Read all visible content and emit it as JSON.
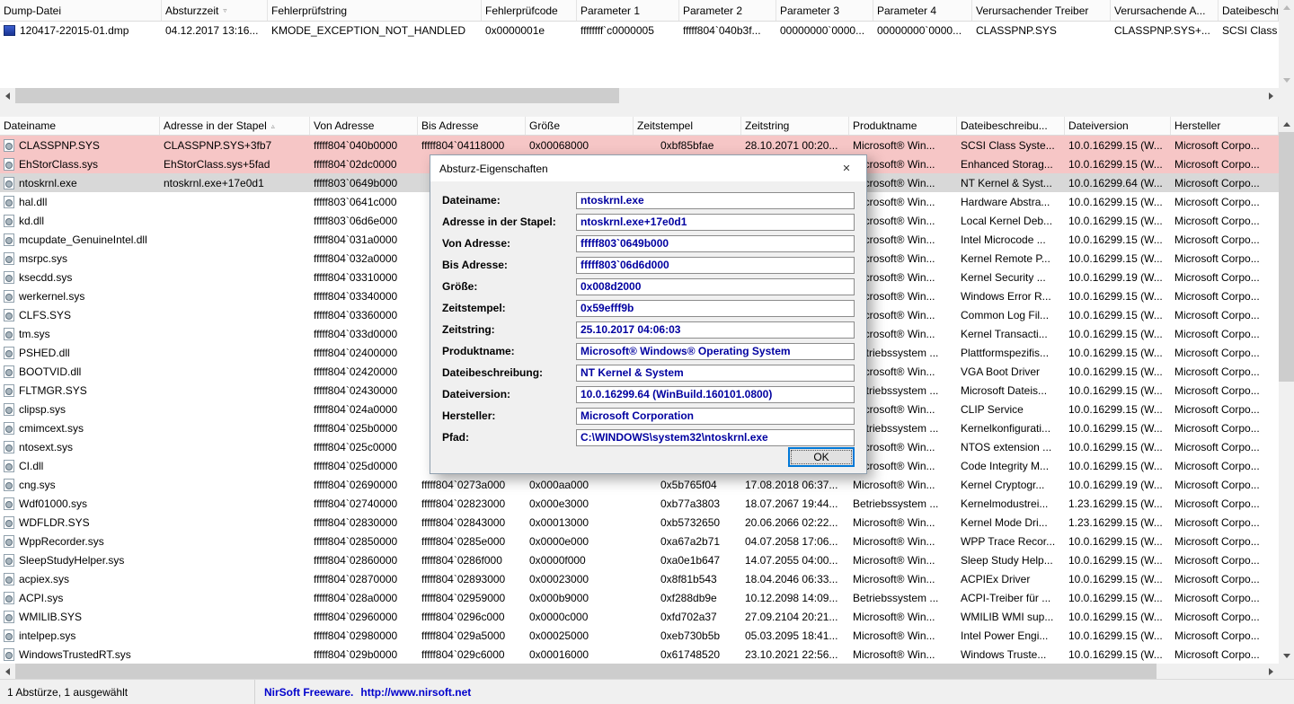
{
  "colors": {
    "pink_row": "#f6c6c6",
    "selected_row": "#d8d8d8",
    "field_text": "#0000a0",
    "accent": "#0078d7",
    "link": "#0000cc"
  },
  "icons": {
    "close": "✕",
    "sort_asc": "▵",
    "sort_desc": "▿"
  },
  "top_pane": {
    "row_icon": "dump-file-icon",
    "columns": [
      {
        "label": "Dump-Datei"
      },
      {
        "label": "Absturzzeit",
        "sort": "desc"
      },
      {
        "label": "Fehlerprüfstring"
      },
      {
        "label": "Fehlerprüfcode"
      },
      {
        "label": "Parameter 1"
      },
      {
        "label": "Parameter 2"
      },
      {
        "label": "Parameter 3"
      },
      {
        "label": "Parameter 4"
      },
      {
        "label": "Verursachender Treiber"
      },
      {
        "label": "Verursachende A..."
      },
      {
        "label": "Dateibeschre..."
      }
    ],
    "rows": [
      {
        "state": "",
        "cells": [
          "120417-22015-01.dmp",
          "04.12.2017 13:16...",
          "KMODE_EXCEPTION_NOT_HANDLED",
          "0x0000001e",
          "ffffffff`c0000005",
          "fffff804`040b3f...",
          "00000000`0000...",
          "00000000`0000...",
          "CLASSPNP.SYS",
          "CLASSPNP.SYS+...",
          "SCSI Class Sy..."
        ]
      }
    ]
  },
  "bottom_pane": {
    "row_icon": "driver-file-icon",
    "columns": [
      {
        "label": "Dateiname"
      },
      {
        "label": "Adresse in der Stapel",
        "sort": "asc"
      },
      {
        "label": "Von Adresse"
      },
      {
        "label": "Bis Adresse"
      },
      {
        "label": "Größe"
      },
      {
        "label": "Zeitstempel"
      },
      {
        "label": "Zeitstring"
      },
      {
        "label": "Produktname"
      },
      {
        "label": "Dateibeschreibu..."
      },
      {
        "label": "Dateiversion"
      },
      {
        "label": "Hersteller"
      }
    ],
    "rows": [
      {
        "state": "pink",
        "cells": [
          "CLASSPNP.SYS",
          "CLASSPNP.SYS+3fb7",
          "fffff804`040b0000",
          "fffff804`04118000",
          "0x00068000",
          "0xbf85bfae",
          "28.10.2071 00:20...",
          "Microsoft® Win...",
          "SCSI Class Syste...",
          "10.0.16299.15 (W...",
          "Microsoft Corpo..."
        ]
      },
      {
        "state": "pink",
        "cells": [
          "EhStorClass.sys",
          "EhStorClass.sys+5fad",
          "fffff804`02dc0000",
          "",
          "",
          "",
          "",
          "Microsoft® Win...",
          "Enhanced Storag...",
          "10.0.16299.15 (W...",
          "Microsoft Corpo..."
        ]
      },
      {
        "state": "selected",
        "cells": [
          "ntoskrnl.exe",
          "ntoskrnl.exe+17e0d1",
          "fffff803`0649b000",
          "",
          "",
          "",
          "",
          "Microsoft® Win...",
          "NT Kernel & Syst...",
          "10.0.16299.64 (W...",
          "Microsoft Corpo..."
        ]
      },
      {
        "state": "",
        "cells": [
          "hal.dll",
          "",
          "fffff803`0641c000",
          "",
          "",
          "",
          "",
          "Microsoft® Win...",
          "Hardware Abstra...",
          "10.0.16299.15 (W...",
          "Microsoft Corpo..."
        ]
      },
      {
        "state": "",
        "cells": [
          "kd.dll",
          "",
          "fffff803`06d6e000",
          "",
          "",
          "",
          "",
          "Microsoft® Win...",
          "Local Kernel Deb...",
          "10.0.16299.15 (W...",
          "Microsoft Corpo..."
        ]
      },
      {
        "state": "",
        "cells": [
          "mcupdate_GenuineIntel.dll",
          "",
          "fffff804`031a0000",
          "",
          "",
          "",
          "",
          "Microsoft® Win...",
          "Intel Microcode ...",
          "10.0.16299.15 (W...",
          "Microsoft Corpo..."
        ]
      },
      {
        "state": "",
        "cells": [
          "msrpc.sys",
          "",
          "fffff804`032a0000",
          "",
          "",
          "",
          "",
          "Microsoft® Win...",
          "Kernel Remote P...",
          "10.0.16299.15 (W...",
          "Microsoft Corpo..."
        ]
      },
      {
        "state": "",
        "cells": [
          "ksecdd.sys",
          "",
          "fffff804`03310000",
          "",
          "",
          "",
          "",
          "Microsoft® Win...",
          "Kernel Security ...",
          "10.0.16299.19 (W...",
          "Microsoft Corpo..."
        ]
      },
      {
        "state": "",
        "cells": [
          "werkernel.sys",
          "",
          "fffff804`03340000",
          "",
          "",
          "",
          "",
          "Microsoft® Win...",
          "Windows Error R...",
          "10.0.16299.15 (W...",
          "Microsoft Corpo..."
        ]
      },
      {
        "state": "",
        "cells": [
          "CLFS.SYS",
          "",
          "fffff804`03360000",
          "",
          "",
          "",
          "",
          "Microsoft® Win...",
          "Common Log Fil...",
          "10.0.16299.15 (W...",
          "Microsoft Corpo..."
        ]
      },
      {
        "state": "",
        "cells": [
          "tm.sys",
          "",
          "fffff804`033d0000",
          "",
          "",
          "",
          "",
          "Microsoft® Win...",
          "Kernel Transacti...",
          "10.0.16299.15 (W...",
          "Microsoft Corpo..."
        ]
      },
      {
        "state": "",
        "cells": [
          "PSHED.dll",
          "",
          "fffff804`02400000",
          "",
          "",
          "",
          "",
          "Betriebssystem ...",
          "Plattformspezifis...",
          "10.0.16299.15 (W...",
          "Microsoft Corpo..."
        ]
      },
      {
        "state": "",
        "cells": [
          "BOOTVID.dll",
          "",
          "fffff804`02420000",
          "",
          "",
          "",
          "",
          "Microsoft® Win...",
          "VGA Boot Driver",
          "10.0.16299.15 (W...",
          "Microsoft Corpo..."
        ]
      },
      {
        "state": "",
        "cells": [
          "FLTMGR.SYS",
          "",
          "fffff804`02430000",
          "",
          "",
          "",
          "",
          "Betriebssystem ...",
          "Microsoft Dateis...",
          "10.0.16299.15 (W...",
          "Microsoft Corpo..."
        ]
      },
      {
        "state": "",
        "cells": [
          "clipsp.sys",
          "",
          "fffff804`024a0000",
          "",
          "",
          "",
          "",
          "Microsoft® Win...",
          "CLIP Service",
          "10.0.16299.15 (W...",
          "Microsoft Corpo..."
        ]
      },
      {
        "state": "",
        "cells": [
          "cmimcext.sys",
          "",
          "fffff804`025b0000",
          "",
          "",
          "",
          "",
          "Betriebssystem ...",
          "Kernelkonfigurati...",
          "10.0.16299.15 (W...",
          "Microsoft Corpo..."
        ]
      },
      {
        "state": "",
        "cells": [
          "ntosext.sys",
          "",
          "fffff804`025c0000",
          "",
          "",
          "",
          "",
          "Microsoft® Win...",
          "NTOS extension ...",
          "10.0.16299.15 (W...",
          "Microsoft Corpo..."
        ]
      },
      {
        "state": "",
        "cells": [
          "CI.dll",
          "",
          "fffff804`025d0000",
          "",
          "",
          "",
          "",
          "Microsoft® Win...",
          "Code Integrity M...",
          "10.0.16299.15 (W...",
          "Microsoft Corpo..."
        ]
      },
      {
        "state": "",
        "cells": [
          "cng.sys",
          "",
          "fffff804`02690000",
          "fffff804`0273a000",
          "0x000aa000",
          "0x5b765f04",
          "17.08.2018 06:37...",
          "Microsoft® Win...",
          "Kernel Cryptogr...",
          "10.0.16299.19 (W...",
          "Microsoft Corpo..."
        ]
      },
      {
        "state": "",
        "cells": [
          "Wdf01000.sys",
          "",
          "fffff804`02740000",
          "fffff804`02823000",
          "0x000e3000",
          "0xb77a3803",
          "18.07.2067 19:44...",
          "Betriebssystem ...",
          "Kernelmodustrei...",
          "1.23.16299.15 (W...",
          "Microsoft Corpo..."
        ]
      },
      {
        "state": "",
        "cells": [
          "WDFLDR.SYS",
          "",
          "fffff804`02830000",
          "fffff804`02843000",
          "0x00013000",
          "0xb5732650",
          "20.06.2066 02:22...",
          "Microsoft® Win...",
          "Kernel Mode Dri...",
          "1.23.16299.15 (W...",
          "Microsoft Corpo..."
        ]
      },
      {
        "state": "",
        "cells": [
          "WppRecorder.sys",
          "",
          "fffff804`02850000",
          "fffff804`0285e000",
          "0x0000e000",
          "0xa67a2b71",
          "04.07.2058 17:06...",
          "Microsoft® Win...",
          "WPP Trace Recor...",
          "10.0.16299.15 (W...",
          "Microsoft Corpo..."
        ]
      },
      {
        "state": "",
        "cells": [
          "SleepStudyHelper.sys",
          "",
          "fffff804`02860000",
          "fffff804`0286f000",
          "0x0000f000",
          "0xa0e1b647",
          "14.07.2055 04:00...",
          "Microsoft® Win...",
          "Sleep Study Help...",
          "10.0.16299.15 (W...",
          "Microsoft Corpo..."
        ]
      },
      {
        "state": "",
        "cells": [
          "acpiex.sys",
          "",
          "fffff804`02870000",
          "fffff804`02893000",
          "0x00023000",
          "0x8f81b543",
          "18.04.2046 06:33...",
          "Microsoft® Win...",
          "ACPIEx Driver",
          "10.0.16299.15 (W...",
          "Microsoft Corpo..."
        ]
      },
      {
        "state": "",
        "cells": [
          "ACPI.sys",
          "",
          "fffff804`028a0000",
          "fffff804`02959000",
          "0x000b9000",
          "0xf288db9e",
          "10.12.2098 14:09...",
          "Betriebssystem ...",
          "ACPI-Treiber für ...",
          "10.0.16299.15 (W...",
          "Microsoft Corpo..."
        ]
      },
      {
        "state": "",
        "cells": [
          "WMILIB.SYS",
          "",
          "fffff804`02960000",
          "fffff804`0296c000",
          "0x0000c000",
          "0xfd702a37",
          "27.09.2104 20:21...",
          "Microsoft® Win...",
          "WMILIB WMI sup...",
          "10.0.16299.15 (W...",
          "Microsoft Corpo..."
        ]
      },
      {
        "state": "",
        "cells": [
          "intelpep.sys",
          "",
          "fffff804`02980000",
          "fffff804`029a5000",
          "0x00025000",
          "0xeb730b5b",
          "05.03.2095 18:41...",
          "Microsoft® Win...",
          "Intel Power Engi...",
          "10.0.16299.15 (W...",
          "Microsoft Corpo..."
        ]
      },
      {
        "state": "",
        "cells": [
          "WindowsTrustedRT.sys",
          "",
          "fffff804`029b0000",
          "fffff804`029c6000",
          "0x00016000",
          "0x61748520",
          "23.10.2021 22:56...",
          "Microsoft® Win...",
          "Windows Truste...",
          "10.0.16299.15 (W...",
          "Microsoft Corpo..."
        ]
      }
    ]
  },
  "dialog": {
    "title": "Absturz-Eigenschaften",
    "fields": [
      {
        "label": "Dateiname:",
        "value": "ntoskrnl.exe"
      },
      {
        "label": "Adresse in der Stapel:",
        "value": "ntoskrnl.exe+17e0d1"
      },
      {
        "label": "Von Adresse:",
        "value": "fffff803`0649b000"
      },
      {
        "label": "Bis Adresse:",
        "value": "fffff803`06d6d000"
      },
      {
        "label": "Größe:",
        "value": "0x008d2000"
      },
      {
        "label": "Zeitstempel:",
        "value": "0x59efff9b"
      },
      {
        "label": "Zeitstring:",
        "value": "25.10.2017 04:06:03"
      },
      {
        "label": "Produktname:",
        "value": "Microsoft® Windows® Operating System"
      },
      {
        "label": "Dateibeschreibung:",
        "value": "NT Kernel & System"
      },
      {
        "label": "Dateiversion:",
        "value": "10.0.16299.64 (WinBuild.160101.0800)"
      },
      {
        "label": "Hersteller:",
        "value": "Microsoft Corporation"
      },
      {
        "label": "Pfad:",
        "value": "C:\\WINDOWS\\system32\\ntoskrnl.exe"
      }
    ],
    "ok_label": "OK"
  },
  "statusbar": {
    "left": "1 Abstürze, 1 ausgewählt",
    "brand": "NirSoft Freeware.",
    "url": "http://www.nirsoft.net"
  }
}
